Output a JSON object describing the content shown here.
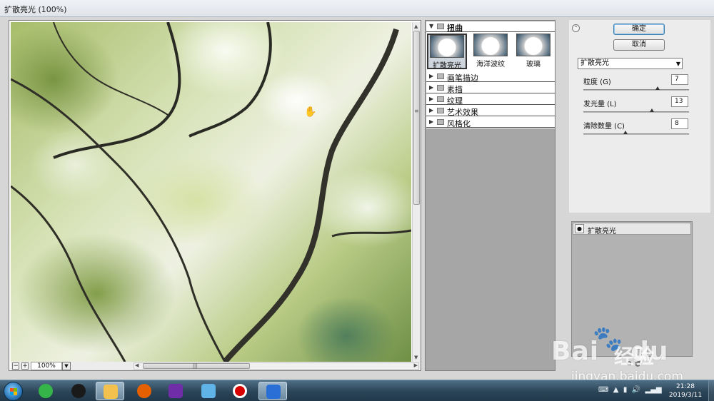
{
  "window": {
    "title": "扩散亮光 (100%)"
  },
  "preview": {
    "zoom_minus": "−",
    "zoom_plus": "+",
    "zoom_value": "100%",
    "zoom_dropdown_icon": "chevron-down-icon",
    "hand_icon": "hand-icon",
    "vscroll_grip": "≡",
    "hscroll_grip": "|||"
  },
  "gallery": {
    "expanded_category": "扭曲",
    "thumbnails": [
      {
        "label": "扩散亮光",
        "selected": true
      },
      {
        "label": "海洋波纹",
        "selected": false
      },
      {
        "label": "玻璃",
        "selected": false
      }
    ],
    "categories": [
      "画笔描边",
      "素描",
      "纹理",
      "艺术效果",
      "风格化"
    ]
  },
  "settings": {
    "ok_label": "确定",
    "cancel_label": "取消",
    "filter_selected": "扩散亮光",
    "params": [
      {
        "label": "粒度 (G)",
        "value": "7",
        "fraction": 0.7
      },
      {
        "label": "发光量 (L)",
        "value": "13",
        "fraction": 0.65
      },
      {
        "label": "清除数量 (C)",
        "value": "8",
        "fraction": 0.4
      }
    ]
  },
  "layers": {
    "items": [
      {
        "label": "扩散亮光",
        "visible": true
      }
    ]
  },
  "watermark": {
    "brand": "Bai",
    "brand2": "du",
    "jingyan": "经验",
    "url": "jingyan.baidu.com"
  },
  "taskbar": {
    "time": "21:28",
    "date": "2019/3/11",
    "colors": {
      "task_browser": "#35b44a",
      "task_qq": "#1a1a1a",
      "task_explorer": "#f2c14e",
      "task_firefox": "#e66000",
      "task_media": "#6f2da8",
      "task_glass": "#5fb3e6",
      "task_record": "#d90000",
      "task_feather": "#2a6fd6"
    }
  }
}
